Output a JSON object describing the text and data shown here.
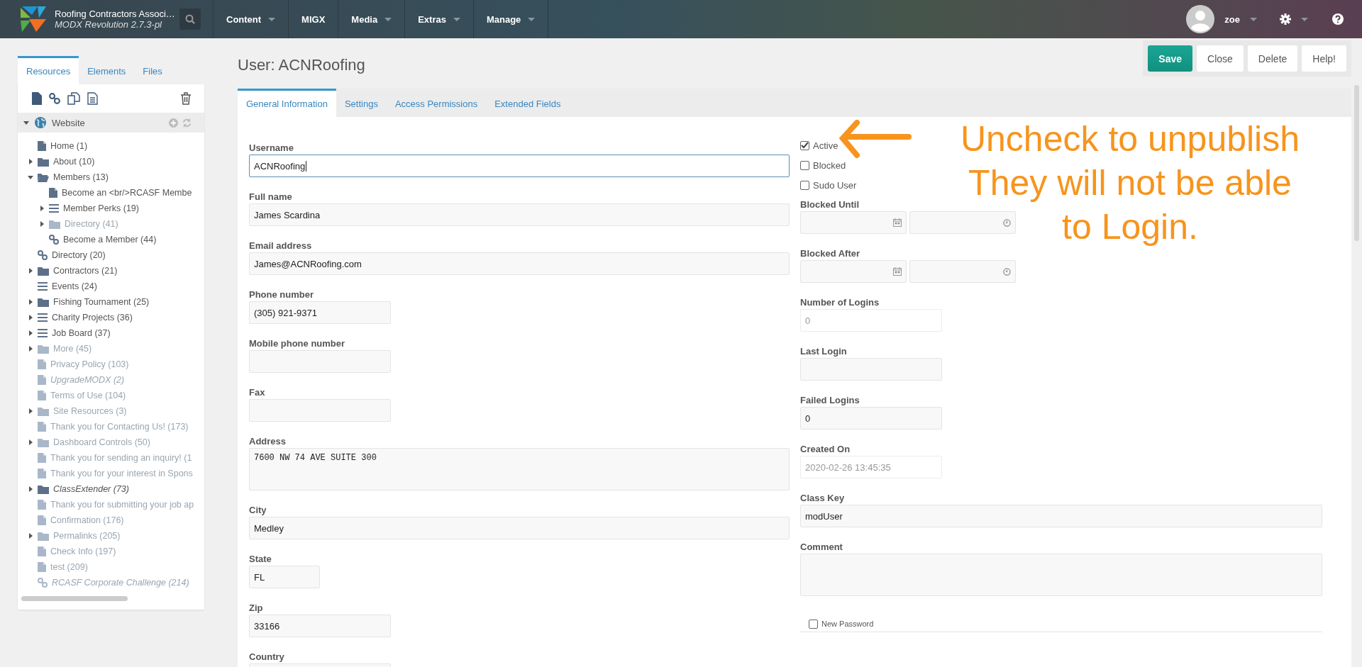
{
  "topbar": {
    "site_name": "Roofing Contractors Associ…",
    "version": "MODX Revolution 2.7.3-pl",
    "menu": [
      {
        "label": "Content",
        "dropdown": true
      },
      {
        "label": "MIGX",
        "dropdown": false
      },
      {
        "label": "Media",
        "dropdown": true
      },
      {
        "label": "Extras",
        "dropdown": true
      },
      {
        "label": "Manage",
        "dropdown": true
      }
    ],
    "user": {
      "name": "zoe"
    }
  },
  "sidebar": {
    "tabs": [
      {
        "label": "Resources",
        "selected": true
      },
      {
        "label": "Elements",
        "selected": false
      },
      {
        "label": "Files",
        "selected": false
      }
    ],
    "root": {
      "label": "Website",
      "expanded": true
    },
    "tree": [
      {
        "label": "Home (1)",
        "kind": "doc",
        "published": true,
        "hidden": false
      },
      {
        "label": "About (10)",
        "kind": "folder",
        "expanded": false,
        "published": true,
        "hidden": false
      },
      {
        "label": "Members (13)",
        "kind": "folder",
        "expanded": true,
        "published": true,
        "hidden": false,
        "children": [
          {
            "label": "Become an <br/>RCASF Membe",
            "kind": "doc",
            "published": true,
            "hidden": false
          },
          {
            "label": "Member Perks (19)",
            "kind": "list",
            "expanded": false,
            "published": true,
            "hidden": false
          },
          {
            "label": "Directory (41)",
            "kind": "folder",
            "expanded": false,
            "published": false,
            "hidden": false
          },
          {
            "label": "Become a Member (44)",
            "kind": "link",
            "published": true,
            "hidden": false
          }
        ]
      },
      {
        "label": "Directory (20)",
        "kind": "link",
        "published": true,
        "hidden": false
      },
      {
        "label": "Contractors (21)",
        "kind": "folder",
        "expanded": false,
        "published": true,
        "hidden": false
      },
      {
        "label": "Events (24)",
        "kind": "list",
        "published": true,
        "hidden": false
      },
      {
        "label": "Fishing Tournament (25)",
        "kind": "folder",
        "expanded": false,
        "published": true,
        "hidden": false
      },
      {
        "label": "Charity Projects (36)",
        "kind": "list",
        "expanded": false,
        "published": true,
        "hidden": false
      },
      {
        "label": "Job Board (37)",
        "kind": "list",
        "expanded": false,
        "published": true,
        "hidden": false
      },
      {
        "label": "More (45)",
        "kind": "folder",
        "expanded": false,
        "published": false,
        "hidden": false
      },
      {
        "label": "Privacy Policy (103)",
        "kind": "doc",
        "published": false,
        "hidden": false
      },
      {
        "label": "UpgradeMODX (2)",
        "kind": "doc",
        "published": false,
        "hidden": true
      },
      {
        "label": "Terms of Use (104)",
        "kind": "doc",
        "published": false,
        "hidden": false
      },
      {
        "label": "Site Resources (3)",
        "kind": "folder",
        "expanded": false,
        "published": false,
        "hidden": false
      },
      {
        "label": "Thank you for Contacting Us! (173)",
        "kind": "doc",
        "published": false,
        "hidden": false
      },
      {
        "label": "Dashboard Controls (50)",
        "kind": "folder",
        "expanded": false,
        "published": false,
        "hidden": false
      },
      {
        "label": "Thank you for sending an inquiry! (1",
        "kind": "doc",
        "published": false,
        "hidden": false
      },
      {
        "label": "Thank you for your interest in Spons",
        "kind": "doc",
        "published": false,
        "hidden": false
      },
      {
        "label": "ClassExtender (73)",
        "kind": "folder",
        "expanded": false,
        "published": true,
        "hidden": true
      },
      {
        "label": "Thank you for submitting your job ap",
        "kind": "doc",
        "published": false,
        "hidden": false
      },
      {
        "label": "Confirmation (176)",
        "kind": "doc",
        "published": false,
        "hidden": false
      },
      {
        "label": "Permalinks (205)",
        "kind": "folder",
        "expanded": false,
        "published": false,
        "hidden": false
      },
      {
        "label": "Check Info (197)",
        "kind": "doc",
        "published": false,
        "hidden": false
      },
      {
        "label": "test (209)",
        "kind": "doc",
        "published": false,
        "hidden": false
      },
      {
        "label": "RCASF Corporate Challenge (214)",
        "kind": "link",
        "published": false,
        "hidden": true
      }
    ]
  },
  "page": {
    "title": "User: ACNRoofing",
    "buttons": [
      {
        "label": "Save",
        "kind": "primary"
      },
      {
        "label": "Close",
        "kind": "plain"
      },
      {
        "label": "Delete",
        "kind": "plain"
      },
      {
        "label": "Help!",
        "kind": "plain"
      }
    ]
  },
  "tabs": [
    {
      "label": "General Information",
      "selected": true
    },
    {
      "label": "Settings",
      "selected": false
    },
    {
      "label": "Access Permissions",
      "selected": false
    },
    {
      "label": "Extended Fields",
      "selected": false
    }
  ],
  "form": {
    "left": [
      {
        "label": "Username",
        "kind": "wide",
        "value": "ACNRoofing",
        "focused": true
      },
      {
        "label": "Full name",
        "kind": "wide",
        "value": "James Scardina",
        "focused": false
      },
      {
        "label": "Email address",
        "kind": "wide",
        "value": "James@ACNRoofing.com",
        "focused": false
      },
      {
        "label": "Phone number",
        "kind": "short",
        "value": "(305) 921-9371",
        "focused": false
      },
      {
        "label": "Mobile phone number",
        "kind": "short",
        "focused": false
      },
      {
        "label": "Fax",
        "kind": "short",
        "focused": false
      },
      {
        "label": "Address",
        "kind": "textarea",
        "value": "7600 NW 74 AVE SUITE 300",
        "focused": false
      },
      {
        "label": "City",
        "kind": "wide",
        "value": "Medley",
        "focused": false
      },
      {
        "label": "State",
        "kind": "tiny",
        "value": "FL",
        "focused": false
      },
      {
        "label": "Zip",
        "kind": "short",
        "value": "33166",
        "focused": false
      },
      {
        "label": "Country",
        "kind": "short"
      }
    ],
    "checkboxes": [
      {
        "label": "Active",
        "checked": true
      },
      {
        "label": "Blocked",
        "checked": false
      },
      {
        "label": "Sudo User",
        "checked": false
      }
    ],
    "right": [
      {
        "label": "Blocked Until",
        "kind": "datetime"
      },
      {
        "label": "Blocked After",
        "kind": "datetime"
      },
      {
        "label": "Number of Logins",
        "kind": "short",
        "value": "0",
        "readonly": true
      },
      {
        "label": "Last Login",
        "kind": "short"
      },
      {
        "label": "Failed Logins",
        "kind": "short",
        "value": "0",
        "readonly": false
      },
      {
        "label": "Created On",
        "kind": "short",
        "value": "2020-02-26 13:45:35",
        "readonly": true
      },
      {
        "label": "Class Key",
        "kind": "wide",
        "value": "modUser",
        "readonly": false
      },
      {
        "label": "Comment",
        "kind": "textarea"
      }
    ],
    "new_password": {
      "label": "New Password",
      "checked": false
    }
  },
  "annotation": {
    "lines": [
      "Uncheck to unpublish",
      "They will not be able",
      "to Login."
    ]
  }
}
